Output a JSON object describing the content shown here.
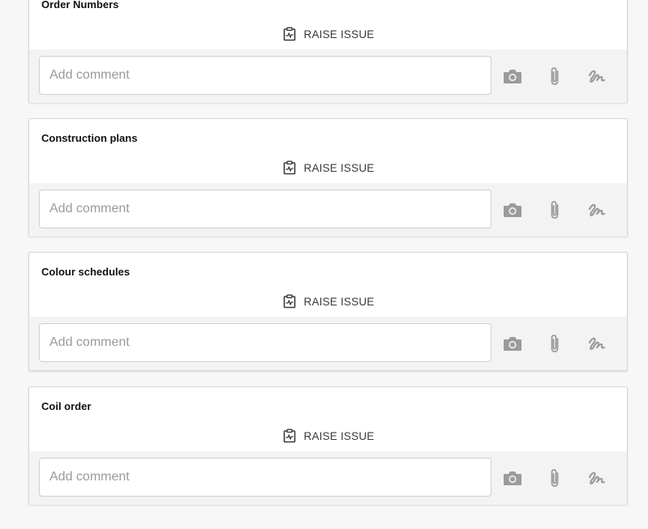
{
  "cards": [
    {
      "title": "Order Numbers",
      "raise_label": "RAISE ISSUE",
      "comment_placeholder": "Add comment",
      "comment_value": ""
    },
    {
      "title": "Construction plans",
      "raise_label": "RAISE ISSUE",
      "comment_placeholder": "Add comment",
      "comment_value": ""
    },
    {
      "title": "Colour schedules",
      "raise_label": "RAISE ISSUE",
      "comment_placeholder": "Add comment",
      "comment_value": ""
    },
    {
      "title": "Coil order",
      "raise_label": "RAISE ISSUE",
      "comment_placeholder": "Add comment",
      "comment_value": ""
    }
  ],
  "icons": {
    "raise_issue": "clipboard-pulse-icon",
    "photo": "camera-icon",
    "attach": "paperclip-icon",
    "signature": "signature-icon"
  },
  "colors": {
    "background": "#f7f7f7",
    "card": "#ffffff",
    "comment_bar": "#f3f3f3",
    "icon_gray": "#9b9b9b",
    "text_dark": "#3a3a3a"
  }
}
